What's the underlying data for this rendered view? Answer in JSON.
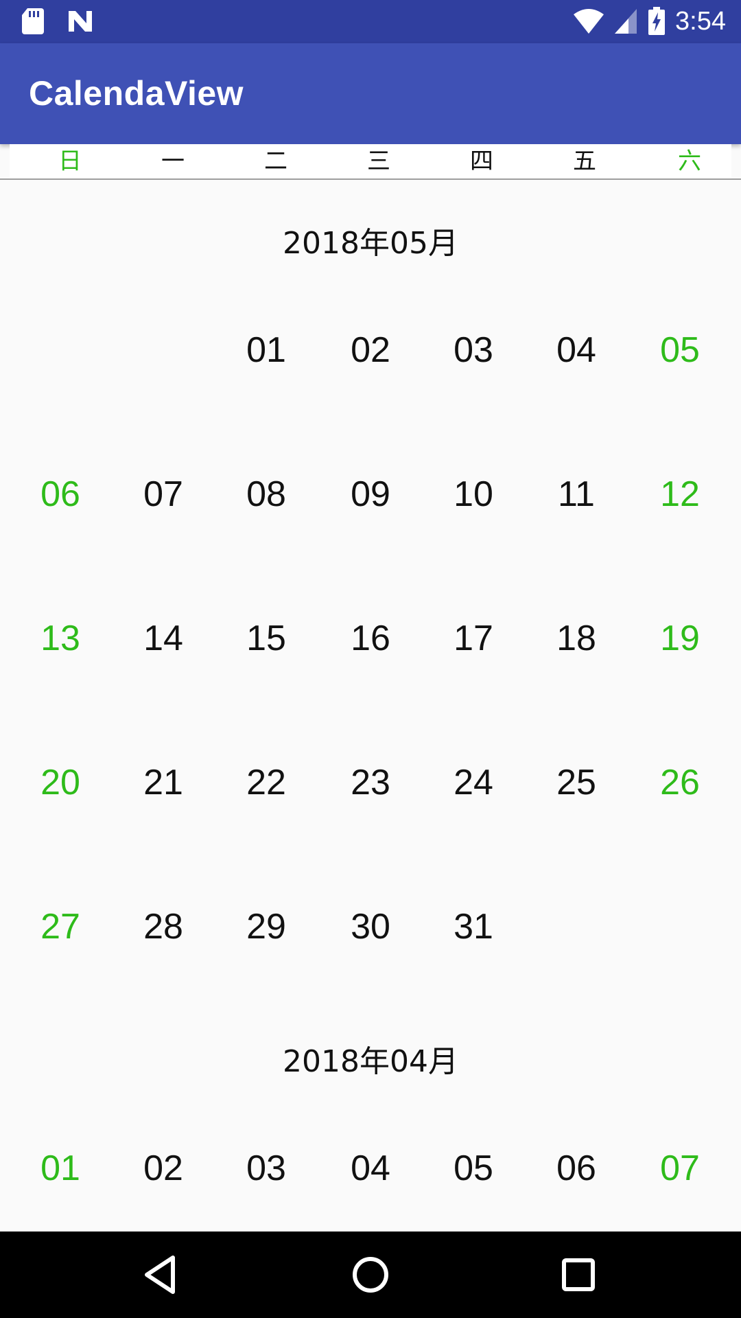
{
  "status_bar": {
    "time": "3:54",
    "icons": [
      "sd-card-icon",
      "n-notification-icon",
      "wifi-icon",
      "cell-signal-icon",
      "battery-charging-icon"
    ]
  },
  "app_bar": {
    "title": "CalendaView"
  },
  "weekdays": [
    "日",
    "一",
    "二",
    "三",
    "四",
    "五",
    "六"
  ],
  "colors": {
    "status_bar": "#303F9F",
    "app_bar": "#3F51B5",
    "weekend": "#2EBB1A",
    "text": "#111111"
  },
  "months": [
    {
      "title": "2018年05月",
      "weeks": [
        [
          "",
          "",
          "01",
          "02",
          "03",
          "04",
          "05"
        ],
        [
          "06",
          "07",
          "08",
          "09",
          "10",
          "11",
          "12"
        ],
        [
          "13",
          "14",
          "15",
          "16",
          "17",
          "18",
          "19"
        ],
        [
          "20",
          "21",
          "22",
          "23",
          "24",
          "25",
          "26"
        ],
        [
          "27",
          "28",
          "29",
          "30",
          "31",
          "",
          ""
        ]
      ]
    },
    {
      "title": "2018年04月",
      "weeks": [
        [
          "01",
          "02",
          "03",
          "04",
          "05",
          "06",
          "07"
        ]
      ]
    }
  ],
  "nav_bar": {
    "icons": [
      "back-icon",
      "home-icon",
      "recents-icon"
    ]
  }
}
